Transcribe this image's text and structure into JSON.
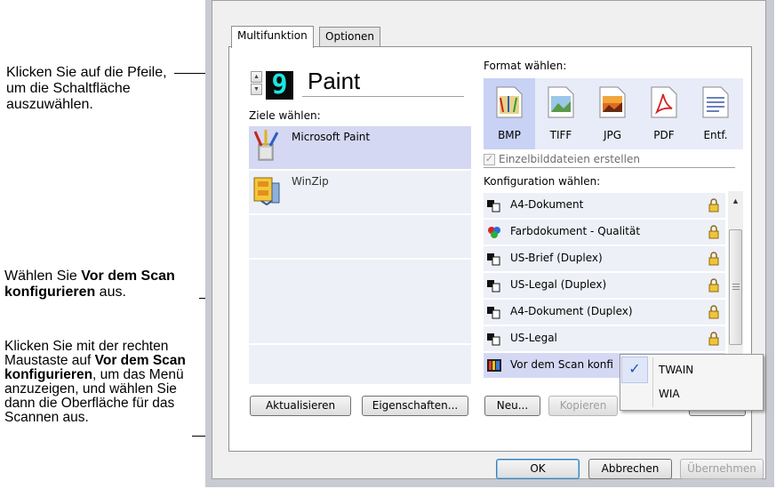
{
  "callouts": {
    "arrows": "Klicken Sie auf die Pfeile, um die Schaltfläche auszuwählen.",
    "konfig_a": "Wählen Sie ",
    "konfig_b": "Vor dem Scan konfigurieren",
    "konfig_c": " aus.",
    "menu_a": "Klicken Sie mit der rechten Maustaste auf ",
    "menu_b": "Vor dem Scan konfigurieren",
    "menu_c": ", um das Menü anzuzeigen, und wählen Sie dann die Oberfläche für das Scannen aus."
  },
  "tabs": [
    "Multifunktion",
    "Optionen"
  ],
  "button": {
    "number": "9",
    "name": "Paint"
  },
  "targets": {
    "label": "Ziele wählen:",
    "items": [
      "Microsoft Paint",
      "WinZip"
    ]
  },
  "format": {
    "label": "Format wählen:",
    "items": [
      "BMP",
      "TIFF",
      "JPG",
      "PDF",
      "Entf."
    ],
    "checkbox_label": "Einzelbilddateien erstellen"
  },
  "config": {
    "label": "Konfiguration wählen:",
    "items": [
      "A4-Dokument",
      "Farbdokument - Qualität",
      "US-Brief (Duplex)",
      "US-Legal (Duplex)",
      "A4-Dokument (Duplex)",
      "US-Legal",
      "Vor dem Scan konfi"
    ]
  },
  "context_menu": [
    "TWAIN",
    "WIA"
  ],
  "buttons": {
    "refresh": "Aktualisieren",
    "properties": "Eigenschaften...",
    "new": "Neu...",
    "copy": "Kopieren",
    "ok": "OK",
    "cancel": "Abbrechen",
    "apply": "Übernehmen"
  },
  "colors": {
    "selection": "#d4d8f2",
    "digit": "#19e8e0",
    "window_bg": "#f0f0f0"
  }
}
